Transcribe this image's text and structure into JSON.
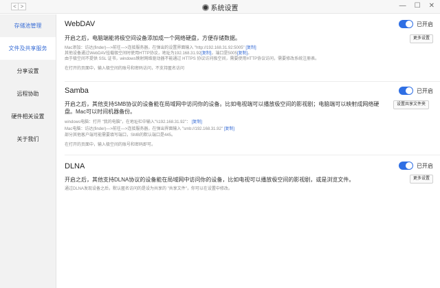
{
  "window": {
    "title": "系统设置",
    "back_glyph": "<",
    "forward_glyph": ">",
    "minimize_glyph": "—",
    "maximize_glyph": "☐",
    "close_glyph": "✕"
  },
  "sidebar": {
    "items": [
      {
        "label": "存储池管理"
      },
      {
        "label": "文件及共享服务"
      },
      {
        "label": "分享设置"
      },
      {
        "label": "远程协助"
      },
      {
        "label": "硬件相关设置"
      },
      {
        "label": "关于我们"
      }
    ]
  },
  "webdav": {
    "title": "WebDAV",
    "toggle_label": "已开启",
    "button_label": "更多设置",
    "desc": "开启之后，电脑端能将极空间设备添加成一个网络硬盘，方便存储数据。",
    "note_1a": "Mac添加：访达(finder)—>前往—>连接服务器，在弹出的设置界面输入 \"http://192.168.31.92:5005\"",
    "note_1b": "[复制]",
    "note_2a": "其他设备通过WebDAV挂载极空间时使用HTTP协议，地址为192.168.31.92",
    "note_2b": "[复制]",
    "note_2c": "，端口是5005",
    "note_2d": "[复制]",
    "note_2e": "。",
    "note_3": "由于极空间不提供 SSL 证书，windows映射网络驱动器不能通过 HTTPS 协议访问极空间，需要使用HTTP协议访问，需要修改系统注册表。",
    "note_4": "在打开的页面中，输入极空间的账号和密码访问，不支持匿名访问"
  },
  "samba": {
    "title": "Samba",
    "toggle_label": "已开启",
    "button_label": "设置共享文件夹",
    "desc": "开启之后，其他支持SMB协议的设备能在局域网中访问你的设备。比如电视端可以播放极空间的影视剧；电脑端可以映射成网络硬盘。Mac可以时间机器备份。",
    "note_1a": "windows电脑：打开 \"我的电脑\"，在地址栏中输入\"\\\\192.168.31.92\"：",
    "note_1b": "[复制]",
    "note_2a": "Mac电脑：访达(finder)—>前往—>连接服务器，在弹出界面输入 \"smb://192.168.31.92\"",
    "note_2b": "[复制]",
    "note_3": "部分其他客户端可能需要填写端口，SMB的默认端口是445。",
    "note_4": "在打开的页面中，输入极空间的账号和密码即可。"
  },
  "dlna": {
    "title": "DLNA",
    "toggle_label": "已开启",
    "button_label": "更多设置",
    "desc": "开启之后，其他支持DLNA协议的设备能在局域网中访问你的设备，比如电视可以播放极空间的影视剧，或是浏览文件。",
    "note_1": "通过DLNA发现设备之后，默认匿名访问的是设为共享的 \"共享文件\"，你可以在设置中修改。"
  },
  "colors": {
    "accent": "#2f6fe4",
    "link": "#3b6fd6"
  }
}
